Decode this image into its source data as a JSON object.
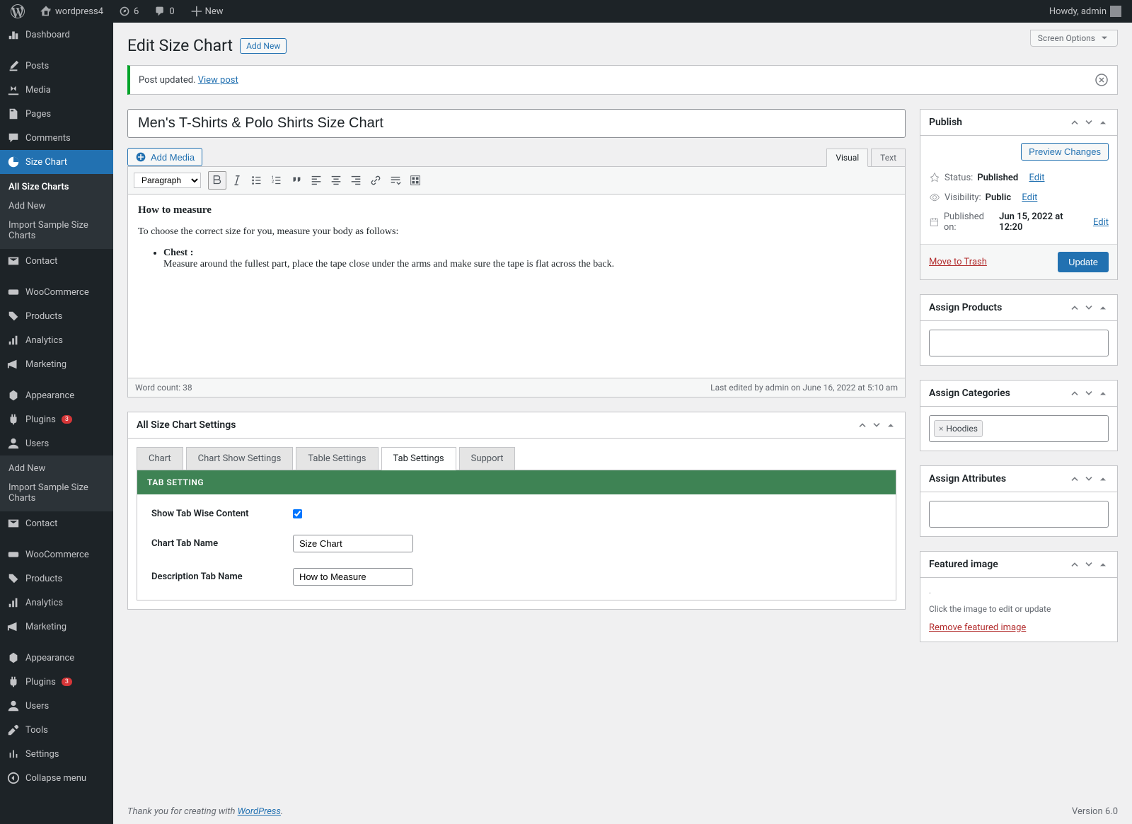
{
  "admin_bar": {
    "site_name": "wordpress4",
    "updates": "6",
    "comments": "0",
    "new_label": "New",
    "howdy": "Howdy, admin"
  },
  "sidebar": {
    "items": [
      {
        "label": "Dashboard"
      },
      {
        "label": "Posts"
      },
      {
        "label": "Media"
      },
      {
        "label": "Pages"
      },
      {
        "label": "Comments"
      },
      {
        "label": "Size Chart"
      },
      {
        "label": "Contact"
      },
      {
        "label": "WooCommerce"
      },
      {
        "label": "Products"
      },
      {
        "label": "Analytics"
      },
      {
        "label": "Marketing"
      },
      {
        "label": "Appearance"
      },
      {
        "label": "Plugins"
      },
      {
        "label": "Users"
      },
      {
        "label": "Tools"
      },
      {
        "label": "Settings"
      },
      {
        "label": "Collapse menu"
      }
    ],
    "plugins_badge": "3",
    "submenu": {
      "all_charts": "All Size Charts",
      "add_new": "Add New",
      "import": "Import Sample Size Charts"
    },
    "submenu2": {
      "add_new": "Add New",
      "import": "Import Sample Size Charts"
    }
  },
  "page": {
    "title": "Edit Size Chart",
    "add_new": "Add New",
    "screen_options": "Screen Options"
  },
  "notice": {
    "text": "Post updated. ",
    "link": "View post"
  },
  "post": {
    "title": "Men's T-Shirts & Polo Shirts Size Chart",
    "add_media": "Add Media",
    "tabs": {
      "visual": "Visual",
      "text": "Text"
    },
    "format_select": "Paragraph",
    "content_heading": "How to measure",
    "content_p1": "To choose the correct size for you, measure your body as follows:",
    "content_li_strong": "Chest :",
    "content_li_text": "Measure around the fullest part, place the tape close under the arms and make sure the tape is flat across the back.",
    "word_count": "Word count: 38",
    "last_edited": "Last edited by admin on June 16, 2022 at 5:10 am"
  },
  "settings_box": {
    "title": "All Size Chart Settings",
    "tabs": [
      "Chart",
      "Chart Show Settings",
      "Table Settings",
      "Tab Settings",
      "Support"
    ],
    "panel_heading": "TAB SETTING",
    "fields": {
      "show_tab_label": "Show Tab Wise Content",
      "chart_tab_label": "Chart Tab Name",
      "chart_tab_value": "Size Chart",
      "desc_tab_label": "Description Tab Name",
      "desc_tab_value": "How to Measure"
    }
  },
  "publish": {
    "title": "Publish",
    "preview": "Preview Changes",
    "status_label": "Status: ",
    "status_value": "Published",
    "visibility_label": "Visibility: ",
    "visibility_value": "Public",
    "published_label": "Published on: ",
    "published_value": "Jun 15, 2022 at 12:20",
    "edit": "Edit",
    "trash": "Move to Trash",
    "update": "Update"
  },
  "assign_products": {
    "title": "Assign Products"
  },
  "assign_categories": {
    "title": "Assign Categories",
    "tag": "Hoodies"
  },
  "assign_attributes": {
    "title": "Assign Attributes"
  },
  "featured_image": {
    "title": "Featured image",
    "hint": "Click the image to edit or update",
    "remove": "Remove featured image"
  },
  "footer": {
    "thank_you": "Thank you for creating with ",
    "wp_link": "WordPress",
    "period": ".",
    "version": "Version 6.0"
  }
}
